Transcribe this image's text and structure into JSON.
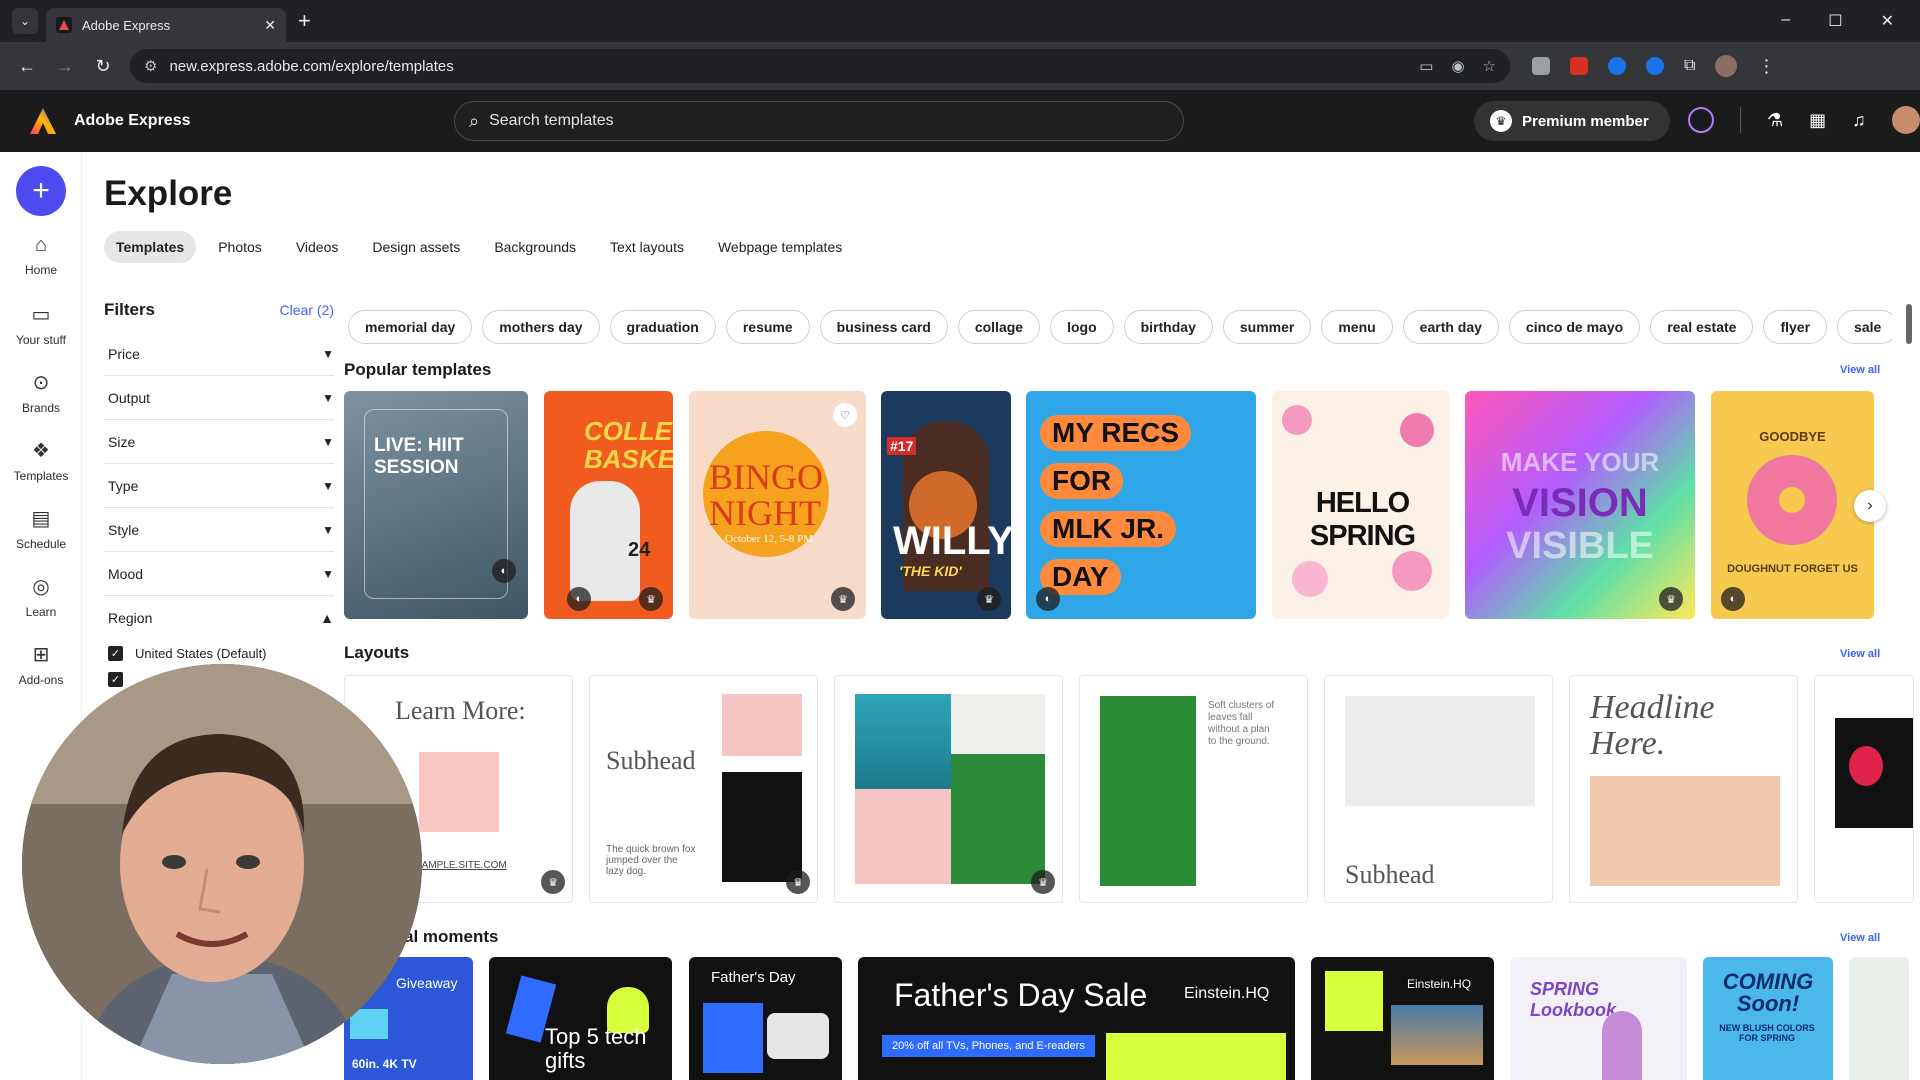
{
  "browser": {
    "tab_title": "Adobe Express",
    "url": "new.express.adobe.com/explore/templates"
  },
  "header": {
    "brand": "Adobe Express",
    "search_placeholder": "Search templates",
    "premium_label": "Premium member"
  },
  "rail": {
    "items": [
      {
        "label": "Home",
        "icon": "home-icon"
      },
      {
        "label": "Your stuff",
        "icon": "folder-icon"
      },
      {
        "label": "Brands",
        "icon": "brand-icon"
      },
      {
        "label": "Templates",
        "icon": "templates-icon"
      },
      {
        "label": "Schedule",
        "icon": "calendar-icon"
      },
      {
        "label": "Learn",
        "icon": "lightbulb-icon"
      },
      {
        "label": "Add-ons",
        "icon": "addons-icon"
      }
    ]
  },
  "main": {
    "title": "Explore",
    "tabs": [
      "Templates",
      "Photos",
      "Videos",
      "Design assets",
      "Backgrounds",
      "Text layouts",
      "Webpage templates"
    ],
    "active_tab": "Templates"
  },
  "filters": {
    "title": "Filters",
    "clear_label": "Clear (2)",
    "groups": [
      "Price",
      "Output",
      "Size",
      "Type",
      "Style",
      "Mood"
    ],
    "region_label": "Region",
    "region_option": "United States (Default)"
  },
  "chips": [
    "memorial day",
    "mothers day",
    "graduation",
    "resume",
    "business card",
    "collage",
    "logo",
    "birthday",
    "summer",
    "menu",
    "earth day",
    "cinco de mayo",
    "real estate",
    "flyer",
    "sale"
  ],
  "sections": {
    "popular": "Popular templates",
    "layouts": "Layouts",
    "moments": "al moments",
    "view_all": "View all"
  },
  "popular_cards": {
    "c1_title": "LIVE: HIIT SESSION",
    "c2_title": "COLLEGE BASKETBALL",
    "c2_num": "24",
    "c3_title": "BINGO NIGHT",
    "c3_date": "October 12, 5-8 PM",
    "c4_num": "#17",
    "c4_title": "WILLY",
    "c4_sub": "'THE KID'",
    "c5_l1": "MY RECS",
    "c5_l2": "FOR",
    "c5_l3": "MLK JR.",
    "c5_l4": "DAY",
    "c6_title": "HELLO SPRING",
    "c7_l1": "MAKE YOUR",
    "c7_l2": "VISION",
    "c7_l3": "VISIBLE",
    "c8_top": "GOODBYE",
    "c8_bottom": "DOUGHNUT FORGET US"
  },
  "layout_cards": {
    "l1_title": "Learn More:",
    "l1_site": "XAMPLE.SITE.COM",
    "l2_title": "Subhead",
    "l2_body": "The quick brown fox jumped over the lazy dog.",
    "l4_body": "Soft clusters of leaves fall without a plan to the ground.",
    "l5_title": "Subhead",
    "l6_title": "Headline Here."
  },
  "moment_cards": {
    "m1_title": "Giveaway",
    "m1_tag": "60in. 4K TV",
    "m2_title": "Top 5 tech gifts",
    "m3_title": "Father's Day",
    "m4_title": "Father's Day Sale",
    "m4_brand": "Einstein.HQ",
    "m4_sub": "20% off all TVs, Phones, and E-readers",
    "m5_brand": "Einstein.HQ",
    "m6_title": "SPRING Lookbook",
    "m7_title": "COMING Soon!",
    "m7_sub": "NEW BLUSH COLORS FOR SPRING"
  },
  "colors": {
    "accent": "#3b63fb",
    "plus_button": "#4b4bf0",
    "header_bg": "#1b1b1b"
  }
}
